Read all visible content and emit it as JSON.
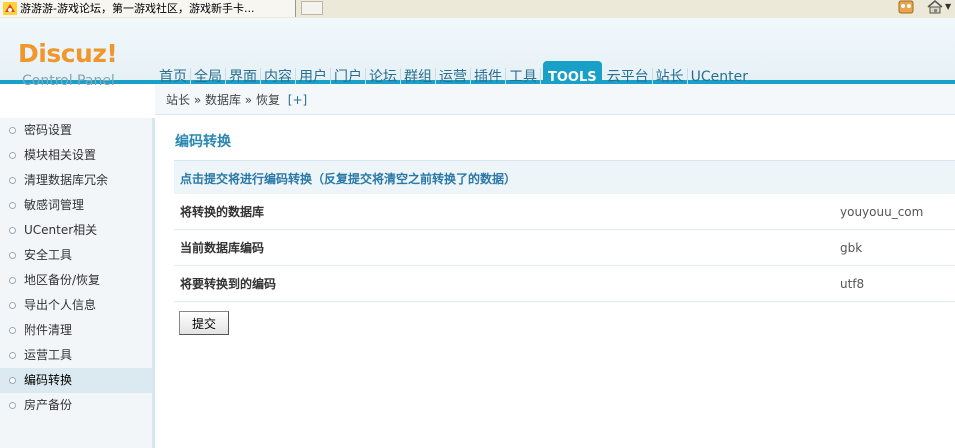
{
  "browser": {
    "tab_title": "游游游-游戏论坛，第一游戏社区，游戏新手卡...",
    "icons": [
      "favicon-icon",
      "feed-icon",
      "home-icon",
      "chevron-down-icon"
    ]
  },
  "header": {
    "logo": "Discuz!",
    "logo_sub": "Control Panel",
    "accent_color": "#19a0c8",
    "nav": [
      "首页",
      "全局",
      "界面",
      "内容",
      "用户",
      "门户",
      "论坛",
      "群组",
      "运营",
      "插件",
      "工具",
      "TOOLS",
      "云平台",
      "站长",
      "UCenter"
    ],
    "active_nav": "TOOLS"
  },
  "breadcrumb": {
    "text": "站长 » 数据库 » 恢复",
    "plus": "[+]"
  },
  "sidebar": {
    "items": [
      {
        "label": "密码设置"
      },
      {
        "label": "模块相关设置"
      },
      {
        "label": "清理数据库冗余"
      },
      {
        "label": "敏感词管理"
      },
      {
        "label": "UCenter相关"
      },
      {
        "label": "安全工具"
      },
      {
        "label": "地区备份/恢复"
      },
      {
        "label": "导出个人信息"
      },
      {
        "label": "附件清理"
      },
      {
        "label": "运营工具"
      },
      {
        "label": "编码转换"
      },
      {
        "label": "房产备份"
      }
    ],
    "active_index": 10
  },
  "main": {
    "title": "编码转换",
    "notice": "点击提交将进行编码转换（反复提交将清空之前转换了的数据）",
    "rows": [
      {
        "label": "将转换的数据库",
        "value": "youyouu_com"
      },
      {
        "label": "当前数据库编码",
        "value": "gbk"
      },
      {
        "label": "将要转换到的编码",
        "value": "utf8"
      }
    ],
    "submit_label": "提交"
  }
}
